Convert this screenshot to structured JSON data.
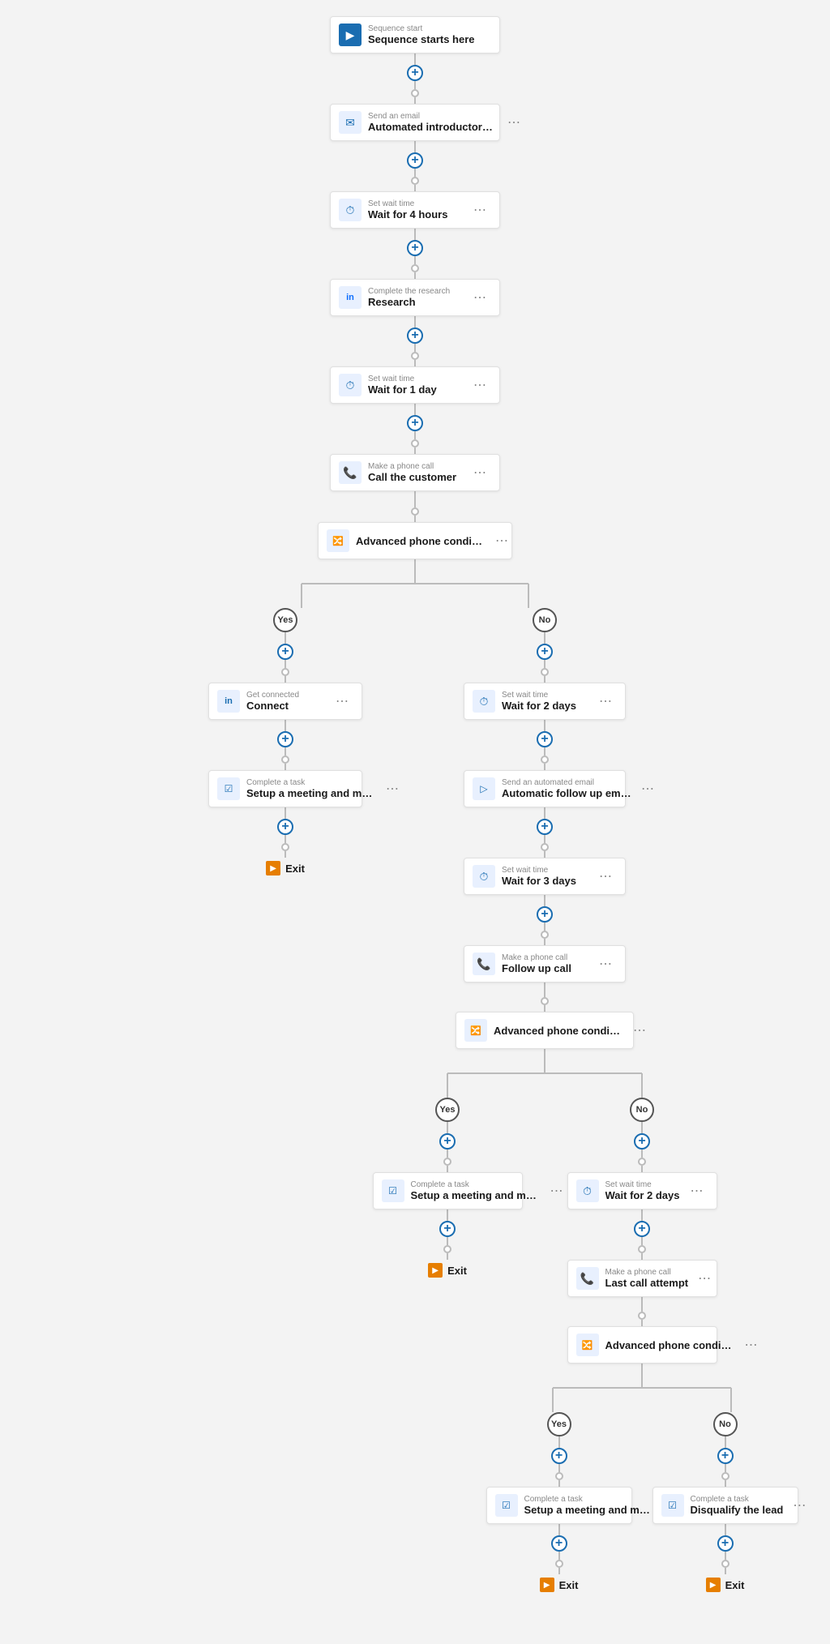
{
  "nodes": {
    "sequence_start": {
      "label": "Sequence start",
      "title": "Sequence starts here"
    },
    "send_email_1": {
      "label": "Send an email",
      "title": "Automated introductory email"
    },
    "wait_1": {
      "label": "Set wait time",
      "title": "Wait for 4 hours"
    },
    "research": {
      "label": "Complete the research",
      "title": "Research"
    },
    "wait_2": {
      "label": "Set wait time",
      "title": "Wait for 1 day"
    },
    "phone_call_1": {
      "label": "Make a phone call",
      "title": "Call the customer"
    },
    "adv_phone_1": {
      "label": "",
      "title": "Advanced phone condition"
    },
    "yes_label_1": "Yes",
    "no_label_1": "No",
    "connect": {
      "label": "Get connected",
      "title": "Connect"
    },
    "task_1_left": {
      "label": "Complete a task",
      "title": "Setup a meeting and move to the next s..."
    },
    "exit_1": "Exit",
    "wait_no_1": {
      "label": "Set wait time",
      "title": "Wait for 2 days"
    },
    "auto_email": {
      "label": "Send an automated email",
      "title": "Automatic follow up email"
    },
    "wait_no_2": {
      "label": "Set wait time",
      "title": "Wait for 3 days"
    },
    "phone_call_2": {
      "label": "Make a phone call",
      "title": "Follow up call"
    },
    "adv_phone_2": {
      "label": "",
      "title": "Advanced phone condition"
    },
    "yes_label_2": "Yes",
    "no_label_2": "No",
    "task_yes_2": {
      "label": "Complete a task",
      "title": "Setup a meeting and move to the next s..."
    },
    "exit_2": "Exit",
    "wait_no_3": {
      "label": "Set wait time",
      "title": "Wait for 2 days"
    },
    "phone_call_3": {
      "label": "Make a phone call",
      "title": "Last call attempt"
    },
    "adv_phone_3": {
      "label": "",
      "title": "Advanced phone condition"
    },
    "yes_label_3": "Yes",
    "no_label_3": "No",
    "task_yes_3": {
      "label": "Complete a task",
      "title": "Setup a meeting and move to the next s..."
    },
    "task_no_3": {
      "label": "Complete a task",
      "title": "Disqualify the lead"
    },
    "exit_3": "Exit",
    "exit_4": "Exit"
  },
  "icons": {
    "start": "▶",
    "email": "✉",
    "wait": "⏱",
    "linkedin": "in",
    "phone": "📞",
    "condition": "🔀",
    "task": "☑",
    "exit": "▶",
    "more": "⋯"
  }
}
